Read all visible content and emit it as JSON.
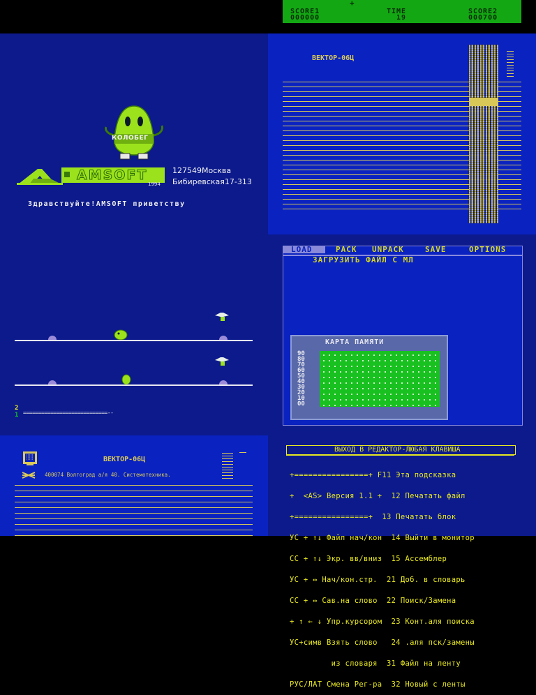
{
  "score_panel": {
    "score1_label": "SCORE1",
    "score1_value": "000000",
    "time_label": "TIME",
    "time_value": "19",
    "score2_label": "SCORE2",
    "score2_value": "000700",
    "marker": "+"
  },
  "title_screen": {
    "mascot_label": "КОЛОБЕГ",
    "logo_text": "AMSOFT",
    "logo_year": "1994",
    "address_line1": "127549Москва",
    "address_line2": "Бибиревская17-313",
    "greeting": "Здравствуйте!AMSOFT приветству",
    "lane_counter_top": "2",
    "lane_counter_bottom": "1",
    "progress_bar": "============================--"
  },
  "vector_screen": {
    "title": "ВЕКТОР-06Ц"
  },
  "loader": {
    "menu": [
      "LOAD",
      "PACK",
      "UNPACK",
      "SAVE",
      "OPTIONS"
    ],
    "status": "ЗАГРУЗИТЬ ФАЙЛ С МЛ",
    "memory_map_title": "КАРТА ПАМЯТИ",
    "memory_rows": [
      "90",
      "80",
      "70",
      "60",
      "50",
      "40",
      "30",
      "20",
      "10",
      "00"
    ]
  },
  "bottom_left": {
    "title": "ВЕКТОР-06Ц",
    "address": "400074 Волгоград а/я 40. Системотехника."
  },
  "help_screen": {
    "header": "ВЫХОД В РЕДАКТОР-ЛЮБАЯ КЛАВИША",
    "lines": [
      "+================+ F11 Эта подсказка",
      "+  <AS> Версия 1.1 +  12 Печатать файл",
      "+================+  13 Печатать блок",
      "УС + ↑↓ Файл нач/кон  14 Выйти в монитор",
      "СС + ↑↓ Экр. вв/вниз  15 Ассемблер",
      "УС + ↔ Нач/кон.стр.  21 Доб. в словарь",
      "СС + ↔ Сав.на слово  22 Поиск/Замена",
      "+ ↑ ← ↓ Упр.курсором  23 Конт.аля поиска",
      "УС+симв Взять слово   24 .аля пск/замены",
      "         из словаря  31 Файл на ленту",
      "РУС/ЛАТ Смена Рег-ра  32 Новый с ленты"
    ]
  },
  "colors": {
    "score_green": "#13a813",
    "dark_blue": "#0c1a8c",
    "bright_blue": "#0a22c0",
    "yellow": "#e8e820",
    "lime": "#9be21c"
  }
}
